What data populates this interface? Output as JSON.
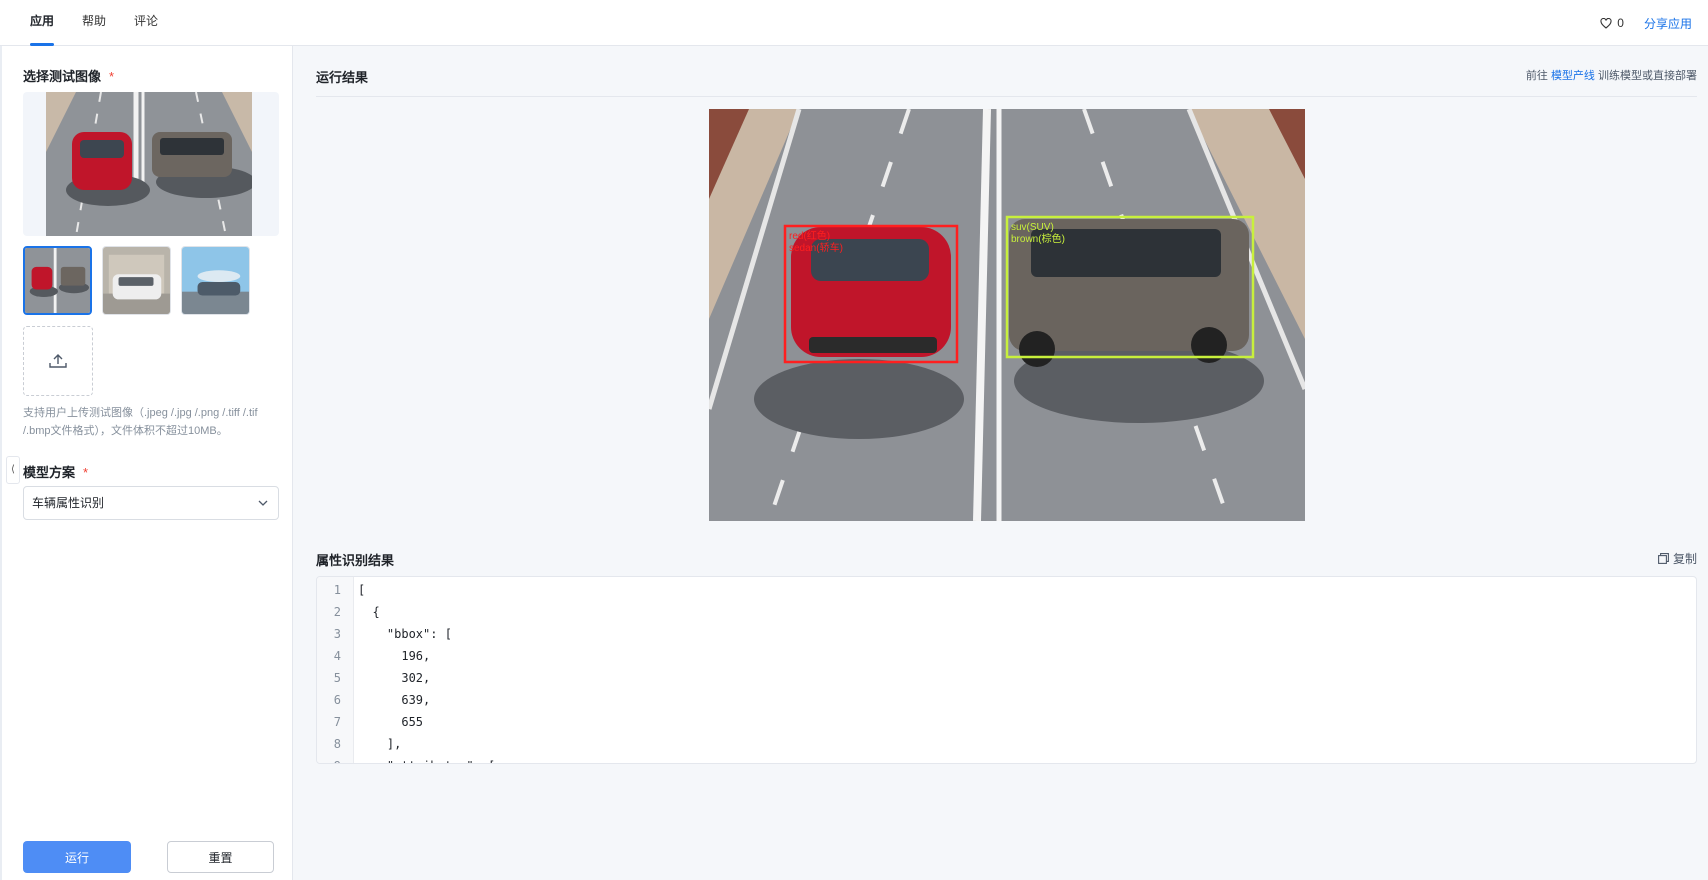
{
  "tabs": [
    {
      "label": "应用",
      "active": true
    },
    {
      "label": "帮助",
      "active": false
    },
    {
      "label": "评论",
      "active": false
    }
  ],
  "header": {
    "like_count": "0",
    "share_label": "分享应用",
    "accent": "#1a73e8"
  },
  "sidebar": {
    "select_image_title": "选择测试图像",
    "required_mark": "*",
    "upload_hint": "支持用户上传测试图像（.jpeg /.jpg /.png /.tiff /.tif /.bmp文件格式），文件体积不超过10MB。",
    "model_title": "模型方案",
    "model_value": "车辆属性识别",
    "collapse_glyph": "⟨",
    "run_label": "运行",
    "reset_label": "重置"
  },
  "main": {
    "result_title": "运行结果",
    "goto_prefix": "前往",
    "goto_link": "模型产线",
    "goto_suffix": "训练模型或直接部署",
    "detections": [
      {
        "line1": "red(红色)",
        "line2": "sedan(轿车)",
        "color": "#ff1f1f"
      },
      {
        "line1": "suv(SUV)",
        "line2": "brown(棕色)",
        "color": "#c8f03c"
      }
    ],
    "attr_title": "属性识别结果",
    "copy_label": "复制",
    "code_lines": [
      "[",
      "  {",
      "    \"bbox\": [",
      "      196,",
      "      302,",
      "      639,",
      "      655",
      "    ],",
      "    \"attributes\": ["
    ]
  }
}
